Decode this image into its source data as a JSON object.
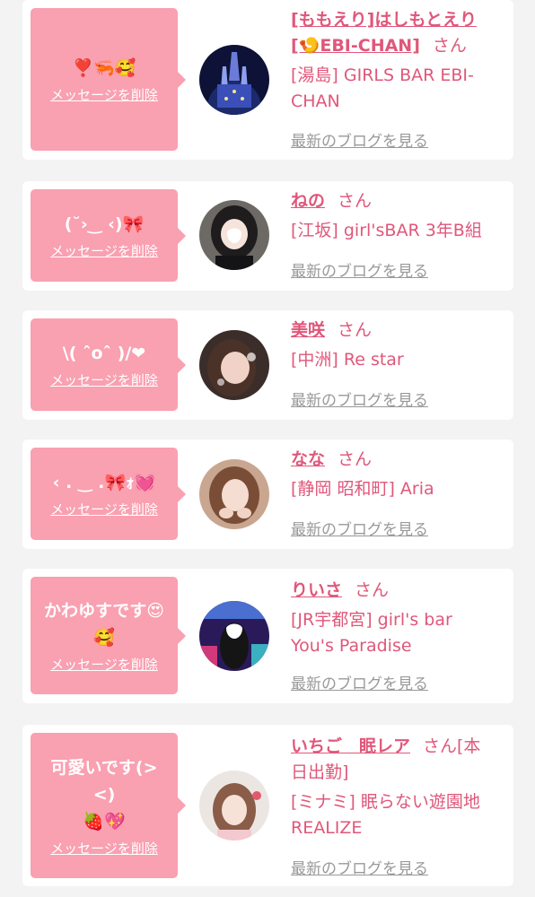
{
  "favorites": [
    {
      "message": "❣️🦐🥰",
      "delete_label": "メッセージを削除",
      "name": "[ももえり]はしもとえり[🍤EBI-CHAN]",
      "honorific": "さん",
      "shop": "[湯島] GIRLS BAR EBI-CHAN",
      "blog_label": "最新のブログを見る"
    },
    {
      "message": "(˘›‿ ‹)🎀",
      "delete_label": "メッセージを削除",
      "name": "ねの",
      "honorific": "さん",
      "shop": "[江坂] girl'sBAR 3年B組",
      "blog_label": "最新のブログを見る"
    },
    {
      "message": "\\( ˆoˆ )/❤",
      "delete_label": "メッセージを削除",
      "name": "美咲",
      "honorific": "さん",
      "shop": "[中洲] Re star",
      "blog_label": "最新のブログを見る"
    },
    {
      "message": "‹ . ‿ .🎀ｫ💓",
      "delete_label": "メッセージを削除",
      "name": "なな",
      "honorific": "さん",
      "shop": "[静岡 昭和町] Aria",
      "blog_label": "最新のブログを見る"
    },
    {
      "message": "かわゆすです😍\n🥰",
      "delete_label": "メッセージを削除",
      "name": "りいさ",
      "honorific": "さん",
      "shop": "[JR宇都宮] girl's bar You's Paradise",
      "blog_label": "最新のブログを見る"
    },
    {
      "message": "可愛いです(> <)\n🍓💖",
      "delete_label": "メッセージを削除",
      "name": "いちご　眠レア",
      "honorific": "さん[本日出勤]",
      "shop": "[ミナミ] 眠らない遊園地 REALIZE",
      "blog_label": "最新のブログを見る"
    }
  ],
  "colors": {
    "page_bg": "#f3f3f3",
    "bubble": "#f9a0b1",
    "accent_text": "#e0577a",
    "muted_link": "#999999"
  }
}
